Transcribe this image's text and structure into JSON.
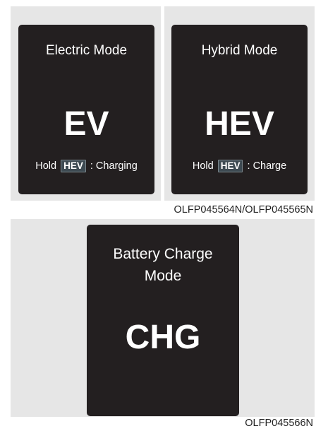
{
  "top_panels": [
    {
      "title": "Electric Mode",
      "mode": "EV",
      "hint": {
        "prefix": "Hold",
        "button": "HEV",
        "suffix": ": Charging"
      }
    },
    {
      "title": "Hybrid Mode",
      "mode": "HEV",
      "hint": {
        "prefix": "Hold",
        "button": "HEV",
        "suffix": ": Charge"
      }
    }
  ],
  "top_caption": "OLFP045564N/OLFP045565N",
  "bottom_panel": {
    "title_line1": "Battery Charge",
    "title_line2": "Mode",
    "mode": "CHG"
  },
  "bottom_caption": "OLFP045566N",
  "colors": {
    "panel_bg": "#e6e6e6",
    "display": "#231f20",
    "text": "#ffffff"
  }
}
